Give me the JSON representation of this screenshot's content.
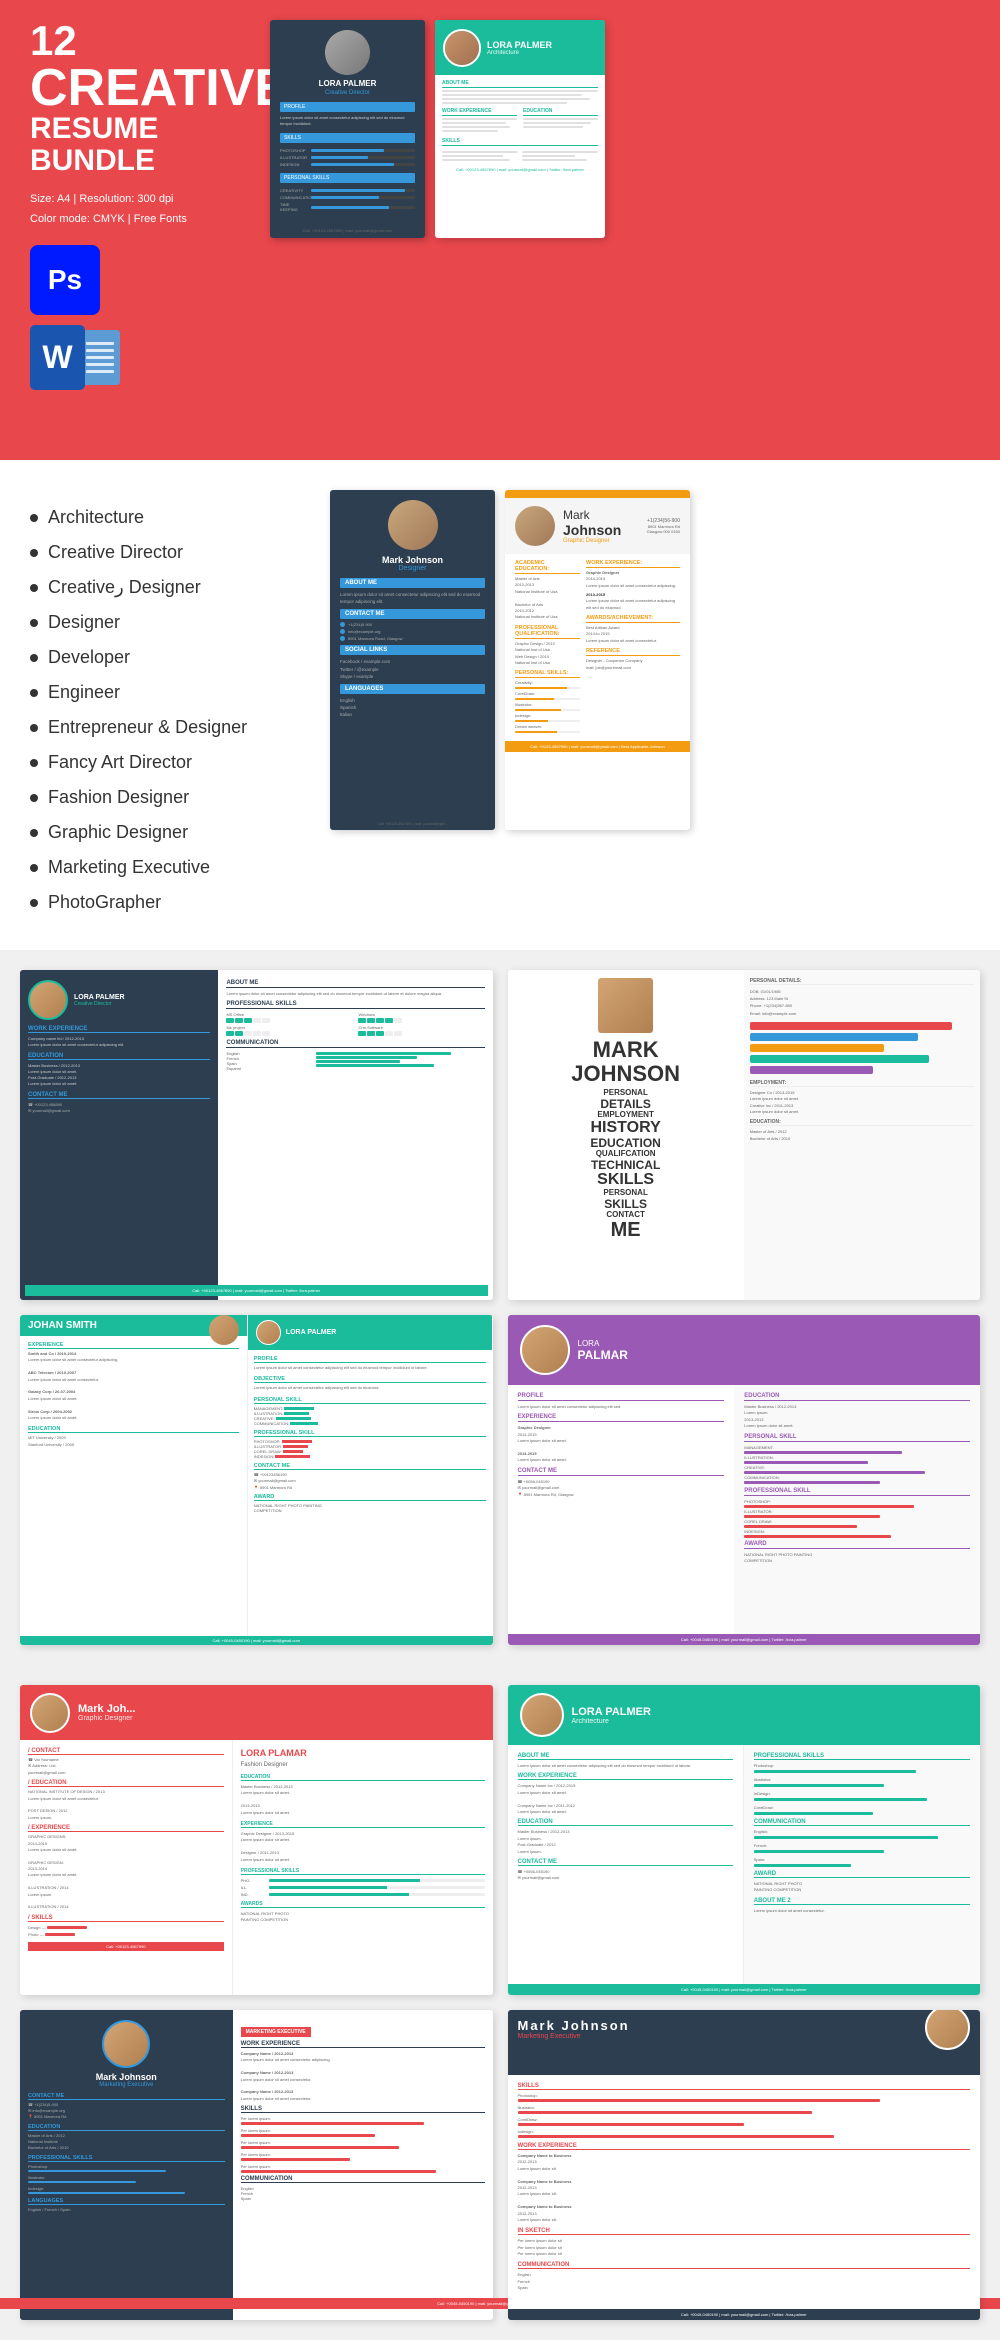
{
  "header": {
    "number": "12",
    "creative": "CREATIVE",
    "resume": "RESUME",
    "bundle": "BUNDLE",
    "specs": {
      "size": "Size: A4 | Resolution: 300 dpi",
      "color": "Color mode: CMYK | Free Fonts"
    },
    "ps_label": "Ps",
    "word_label": "W"
  },
  "bullet_list": {
    "items": [
      "Architecture",
      "Creative Director",
      "Creativeر Designer",
      "Designer",
      "Developer",
      "Engineer",
      "Entrepreneur & Designer",
      "Fancy Art Director",
      "Fashion Designer",
      "Graphic Designer",
      "Marketing Executive",
      "PhotoGrapher"
    ]
  },
  "resumes": {
    "lora_palmer": {
      "name": "LORA PALMER",
      "title": "Creative Director",
      "profile": "PROFILE",
      "professional_skills": "PROFESSIONAL SKILLS",
      "personal_skills": "PERSONAL SKILLS",
      "contact": "CONTACT ME",
      "awards": "AWARDS"
    },
    "architecture": {
      "name": "LORA PALMER",
      "title": "Architecture"
    },
    "mark_johnson": {
      "name": "Mark Johnson",
      "title": "Creative Designer",
      "first": "Mark",
      "last": "Johnson"
    },
    "fashion_designer": {
      "name": "LORA PLAMAR",
      "title": "Fashion Designer"
    },
    "graphic_designer": {
      "name": "Mark Johnson",
      "title": "Graphic Designer"
    },
    "mark_john": {
      "name": "Mark Joh...",
      "title": "Graphic Designer"
    },
    "photographer": {
      "name": "LORA PALMER",
      "title": "PhotoGrapher"
    },
    "marketing": {
      "name": "MARK JOHNSON",
      "title": "Marketing Executive"
    }
  },
  "word_cloud": {
    "words": [
      "MARK",
      "JOHNSON",
      "PERSONAL",
      "DETAILS",
      "EMPLOYMENT",
      "HISTORY",
      "EDUCATION",
      "QUALIFCATION",
      "TECHNICAL",
      "SKILLS",
      "PERSONAL",
      "SKILLS",
      "CONTACT",
      "ME"
    ]
  },
  "resume_sections": {
    "about_me": "ABOUT ME",
    "work_experience": "WORK EXPERIENCE",
    "education": "EDUCATION",
    "skills": "SKILLS",
    "contact": "CONTACT ME",
    "profile": "PROFILE",
    "experience": "EXPERIENCE",
    "awards": "AWARDS",
    "languages": "LANGUAGES",
    "objective": "OBJECTIVE",
    "personal_skill": "PERSONAL SKILL",
    "professional_skill": "PROFESSIONAL SKILL",
    "award": "AWARD"
  },
  "colors": {
    "red": "#e8474c",
    "teal": "#1abc9c",
    "blue": "#3498db",
    "dark": "#2c3e50",
    "yellow": "#f39c12",
    "purple": "#9b59b6"
  },
  "names": {
    "lora_palmer": "LORA PALMER",
    "mark_johnson": "Mark Johnson",
    "lora_plamar": "LORA PLAMAR",
    "johan_smith": "JOHAN SMITH",
    "mark_john": "Mark Joh..."
  }
}
